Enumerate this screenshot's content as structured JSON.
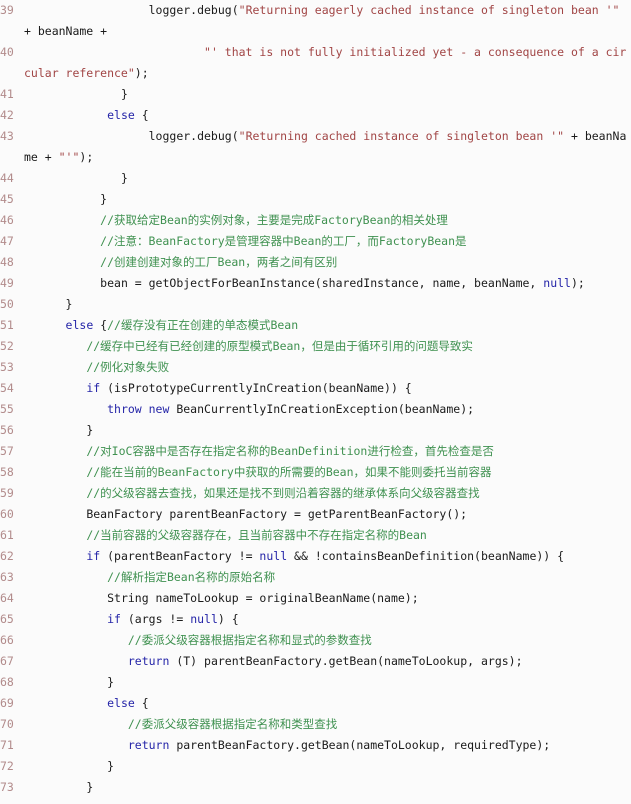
{
  "view": {
    "kind": "code-listing",
    "language": "java",
    "background": "#fbfbfb",
    "line_number_color": "#b28b8b",
    "colors": {
      "keyword": "#2525a8",
      "string": "#a14545",
      "comment": "#3f9150",
      "plain": "#1a1a1a"
    }
  },
  "lines": [
    {
      "number": "39",
      "indent": 18,
      "tokens": [
        {
          "t": "plain",
          "v": "logger.debug("
        },
        {
          "t": "str",
          "v": "\"Returning eagerly cached instance of singleton bean '\""
        },
        {
          "t": "plain",
          "v": " + beanName +"
        }
      ]
    },
    {
      "number": "40",
      "indent": 26,
      "tokens": [
        {
          "t": "str",
          "v": "\"' that is not fully initialized yet - a consequence of a circular reference\""
        },
        {
          "t": "plain",
          "v": ");"
        }
      ]
    },
    {
      "number": "41",
      "indent": 14,
      "tokens": [
        {
          "t": "plain",
          "v": "}"
        }
      ]
    },
    {
      "number": "42",
      "indent": 12,
      "tokens": [
        {
          "t": "kw",
          "v": "else"
        },
        {
          "t": "plain",
          "v": " {"
        }
      ]
    },
    {
      "number": "43",
      "indent": 18,
      "tokens": [
        {
          "t": "plain",
          "v": "logger.debug("
        },
        {
          "t": "str",
          "v": "\"Returning cached instance of singleton bean '\""
        },
        {
          "t": "plain",
          "v": " + beanName + "
        },
        {
          "t": "str",
          "v": "\"'\""
        },
        {
          "t": "plain",
          "v": ");"
        }
      ]
    },
    {
      "number": "44",
      "indent": 14,
      "tokens": [
        {
          "t": "plain",
          "v": "}"
        }
      ]
    },
    {
      "number": "45",
      "indent": 11,
      "tokens": [
        {
          "t": "plain",
          "v": "}"
        }
      ]
    },
    {
      "number": "46",
      "indent": 11,
      "tokens": [
        {
          "t": "cmt",
          "v": "//获取给定Bean的实例对象，主要是完成FactoryBean的相关处理"
        }
      ]
    },
    {
      "number": "47",
      "indent": 11,
      "tokens": [
        {
          "t": "cmt",
          "v": "//注意：BeanFactory是管理容器中Bean的工厂，而FactoryBean是"
        }
      ]
    },
    {
      "number": "48",
      "indent": 11,
      "tokens": [
        {
          "t": "cmt",
          "v": "//创建创建对象的工厂Bean，两者之间有区别"
        }
      ]
    },
    {
      "number": "49",
      "indent": 11,
      "tokens": [
        {
          "t": "plain",
          "v": "bean = getObjectForBeanInstance(sharedInstance, name, beanName, "
        },
        {
          "t": "kw",
          "v": "null"
        },
        {
          "t": "plain",
          "v": ");"
        }
      ]
    },
    {
      "number": "50",
      "indent": 6,
      "tokens": [
        {
          "t": "plain",
          "v": "}"
        }
      ]
    },
    {
      "number": "51",
      "indent": 6,
      "tokens": [
        {
          "t": "kw",
          "v": "else"
        },
        {
          "t": "plain",
          "v": " {"
        },
        {
          "t": "cmt",
          "v": "//缓存没有正在创建的单态模式Bean"
        }
      ]
    },
    {
      "number": "52",
      "indent": 9,
      "tokens": [
        {
          "t": "cmt",
          "v": "//缓存中已经有已经创建的原型模式Bean，但是由于循环引用的问题导致实"
        }
      ]
    },
    {
      "number": "53",
      "indent": 9,
      "tokens": [
        {
          "t": "cmt",
          "v": "//例化对象失败"
        }
      ]
    },
    {
      "number": "54",
      "indent": 9,
      "tokens": [
        {
          "t": "kw",
          "v": "if"
        },
        {
          "t": "plain",
          "v": " (isPrototypeCurrentlyInCreation(beanName)) {"
        }
      ]
    },
    {
      "number": "55",
      "indent": 12,
      "tokens": [
        {
          "t": "kw",
          "v": "throw new"
        },
        {
          "t": "plain",
          "v": " BeanCurrentlyInCreationException(beanName);"
        }
      ]
    },
    {
      "number": "56",
      "indent": 9,
      "tokens": [
        {
          "t": "plain",
          "v": "}"
        }
      ]
    },
    {
      "number": "57",
      "indent": 9,
      "tokens": [
        {
          "t": "cmt",
          "v": "//对IoC容器中是否存在指定名称的BeanDefinition进行检查，首先检查是否"
        }
      ]
    },
    {
      "number": "58",
      "indent": 9,
      "tokens": [
        {
          "t": "cmt",
          "v": "//能在当前的BeanFactory中获取的所需要的Bean，如果不能则委托当前容器"
        }
      ]
    },
    {
      "number": "59",
      "indent": 9,
      "tokens": [
        {
          "t": "cmt",
          "v": "//的父级容器去查找，如果还是找不到则沿着容器的继承体系向父级容器查找"
        }
      ]
    },
    {
      "number": "60",
      "indent": 9,
      "tokens": [
        {
          "t": "plain",
          "v": "BeanFactory parentBeanFactory = getParentBeanFactory();"
        }
      ]
    },
    {
      "number": "61",
      "indent": 9,
      "tokens": [
        {
          "t": "cmt",
          "v": "//当前容器的父级容器存在，且当前容器中不存在指定名称的Bean"
        }
      ]
    },
    {
      "number": "62",
      "indent": 9,
      "tokens": [
        {
          "t": "kw",
          "v": "if"
        },
        {
          "t": "plain",
          "v": " (parentBeanFactory != "
        },
        {
          "t": "kw",
          "v": "null"
        },
        {
          "t": "plain",
          "v": " && !containsBeanDefinition(beanName)) {"
        }
      ]
    },
    {
      "number": "63",
      "indent": 12,
      "tokens": [
        {
          "t": "cmt",
          "v": "//解析指定Bean名称的原始名称"
        }
      ]
    },
    {
      "number": "64",
      "indent": 12,
      "tokens": [
        {
          "t": "plain",
          "v": "String nameToLookup = originalBeanName(name);"
        }
      ]
    },
    {
      "number": "65",
      "indent": 12,
      "tokens": [
        {
          "t": "kw",
          "v": "if"
        },
        {
          "t": "plain",
          "v": " (args != "
        },
        {
          "t": "kw",
          "v": "null"
        },
        {
          "t": "plain",
          "v": ") {"
        }
      ]
    },
    {
      "number": "66",
      "indent": 15,
      "tokens": [
        {
          "t": "cmt",
          "v": "//委派父级容器根据指定名称和显式的参数查找"
        }
      ]
    },
    {
      "number": "67",
      "indent": 15,
      "tokens": [
        {
          "t": "kw",
          "v": "return"
        },
        {
          "t": "plain",
          "v": " (T) parentBeanFactory.getBean(nameToLookup, args);"
        }
      ]
    },
    {
      "number": "68",
      "indent": 12,
      "tokens": [
        {
          "t": "plain",
          "v": "}"
        }
      ]
    },
    {
      "number": "69",
      "indent": 12,
      "tokens": [
        {
          "t": "kw",
          "v": "else"
        },
        {
          "t": "plain",
          "v": " {"
        }
      ]
    },
    {
      "number": "70",
      "indent": 15,
      "tokens": [
        {
          "t": "cmt",
          "v": "//委派父级容器根据指定名称和类型查找"
        }
      ]
    },
    {
      "number": "71",
      "indent": 15,
      "tokens": [
        {
          "t": "kw",
          "v": "return"
        },
        {
          "t": "plain",
          "v": " parentBeanFactory.getBean(nameToLookup, requiredType);"
        }
      ]
    },
    {
      "number": "72",
      "indent": 12,
      "tokens": [
        {
          "t": "plain",
          "v": "}"
        }
      ]
    },
    {
      "number": "73",
      "indent": 9,
      "tokens": [
        {
          "t": "plain",
          "v": "}"
        }
      ]
    }
  ]
}
